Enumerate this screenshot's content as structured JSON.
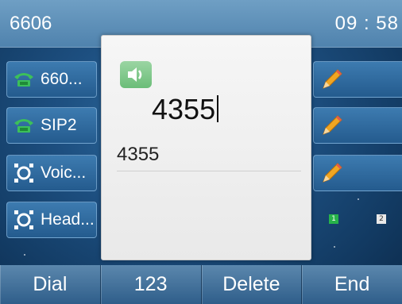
{
  "status_bar": {
    "account": "6606",
    "time": "09 : 58"
  },
  "line_keys_left": [
    {
      "label": "660...",
      "icon": "phone-handset-icon",
      "icon_color": "#3cc05a"
    },
    {
      "label": "SIP2",
      "icon": "phone-handset-icon",
      "icon_color": "#3cc05a"
    },
    {
      "label": "Voic...",
      "icon": "voicemail-icon",
      "icon_color": "#ffffff"
    },
    {
      "label": "Head...",
      "icon": "headset-icon",
      "icon_color": "#ffffff"
    }
  ],
  "line_keys_right": [
    {
      "icon": "edit-pencil-icon"
    },
    {
      "icon": "edit-pencil-icon"
    },
    {
      "icon": "edit-pencil-icon"
    }
  ],
  "page_indicator": {
    "pages": [
      "1",
      "2"
    ],
    "active": "1"
  },
  "dial_dialog": {
    "mode_icon": "speaker-icon",
    "entry": "4355",
    "matches": [
      "4355"
    ]
  },
  "softkeys": [
    "Dial",
    "123",
    "Delete",
    "End"
  ],
  "colors": {
    "accent_green": "#27b34a",
    "softkey_bar": "#3f6d96",
    "background": "#1d4f80"
  }
}
